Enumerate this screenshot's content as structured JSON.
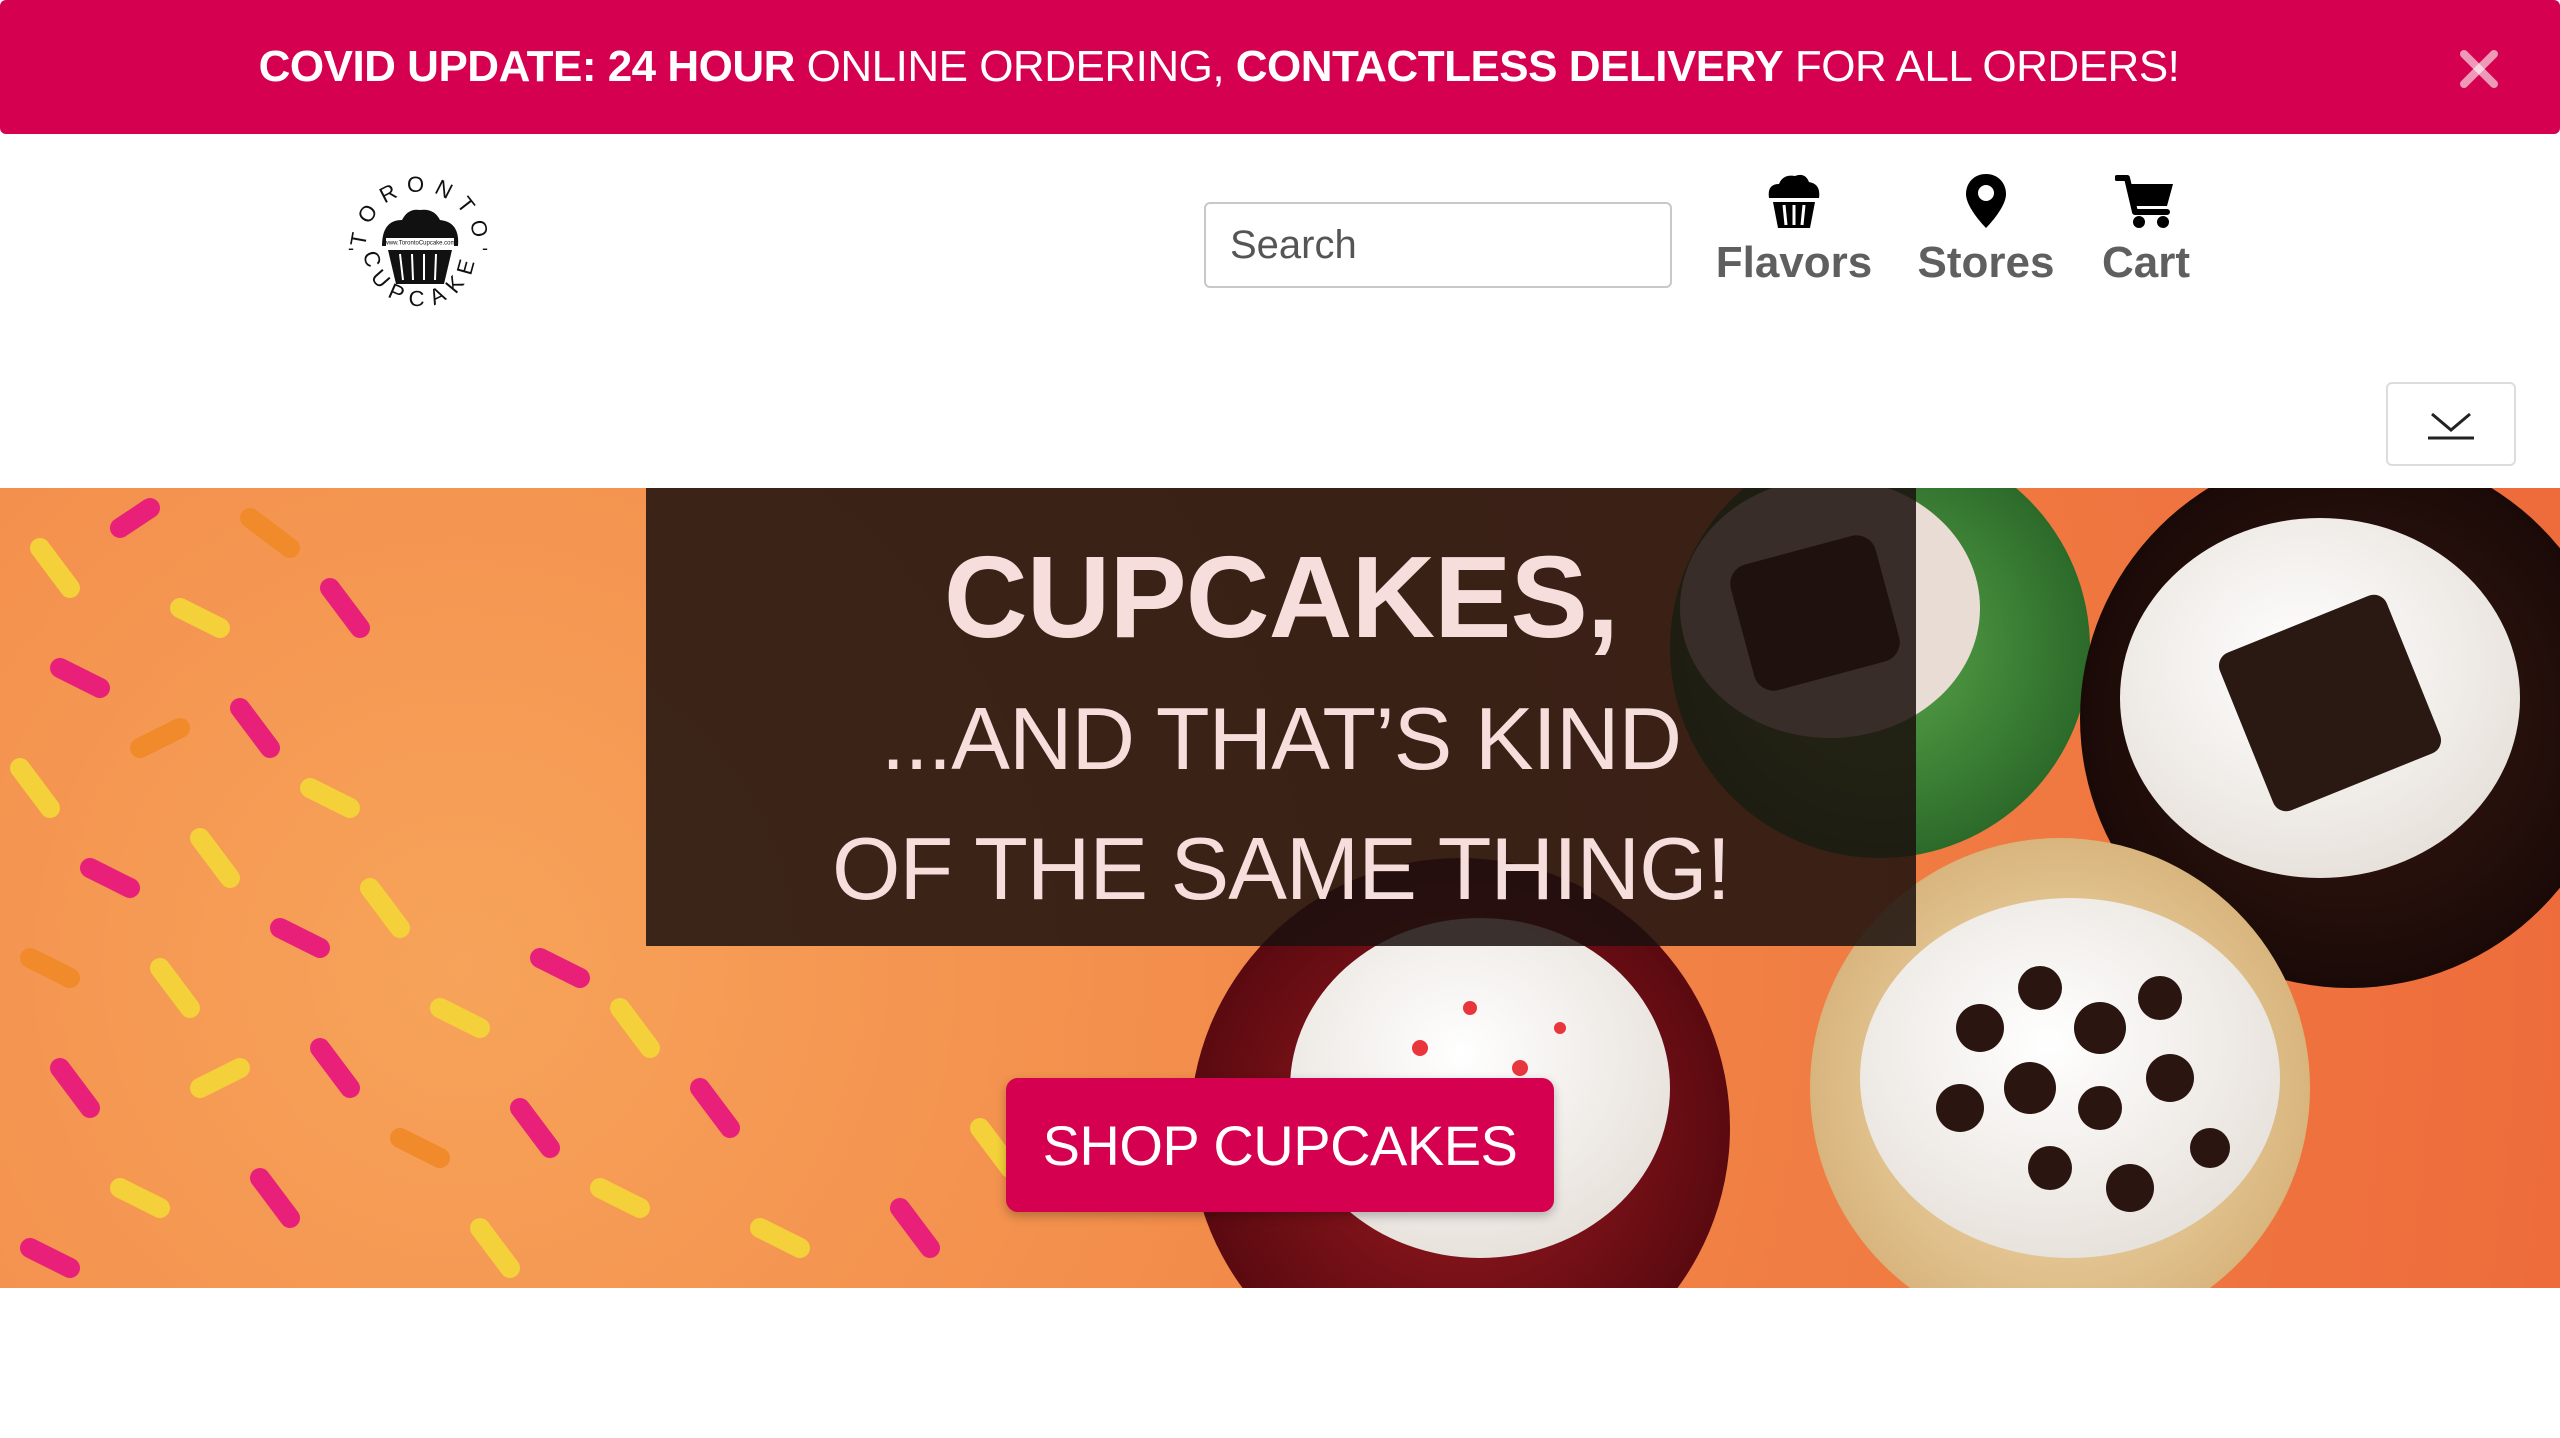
{
  "banner": {
    "prefix_bold": "COVID UPDATE: 24 HOUR",
    "middle": " ONLINE ORDERING, ",
    "contactless_bold": "CONTACTLESS DELIVERY",
    "suffix": " FOR ALL ORDERS!",
    "close_icon": "close-icon",
    "background_color": "#d5004f"
  },
  "logo": {
    "ring_text": "TORONTO CUPCAKE",
    "inner_text": "www.TorontoCupcake.com",
    "icon": "cupcake-icon"
  },
  "search": {
    "placeholder": "Search",
    "value": ""
  },
  "nav": {
    "flavors": {
      "label": "Flavors",
      "icon": "cupcake-icon"
    },
    "stores": {
      "label": "Stores",
      "icon": "map-pin-icon"
    },
    "cart": {
      "label": "Cart",
      "icon": "cart-icon"
    }
  },
  "toggler": {
    "icon": "chevron-down-icon"
  },
  "hero": {
    "line1": "CUPCAKES,",
    "line2": "...AND THAT’S KIND",
    "line3": "OF THE SAME THING!",
    "cta_label": "SHOP CUPCAKES",
    "accent_color": "#d5004f"
  }
}
